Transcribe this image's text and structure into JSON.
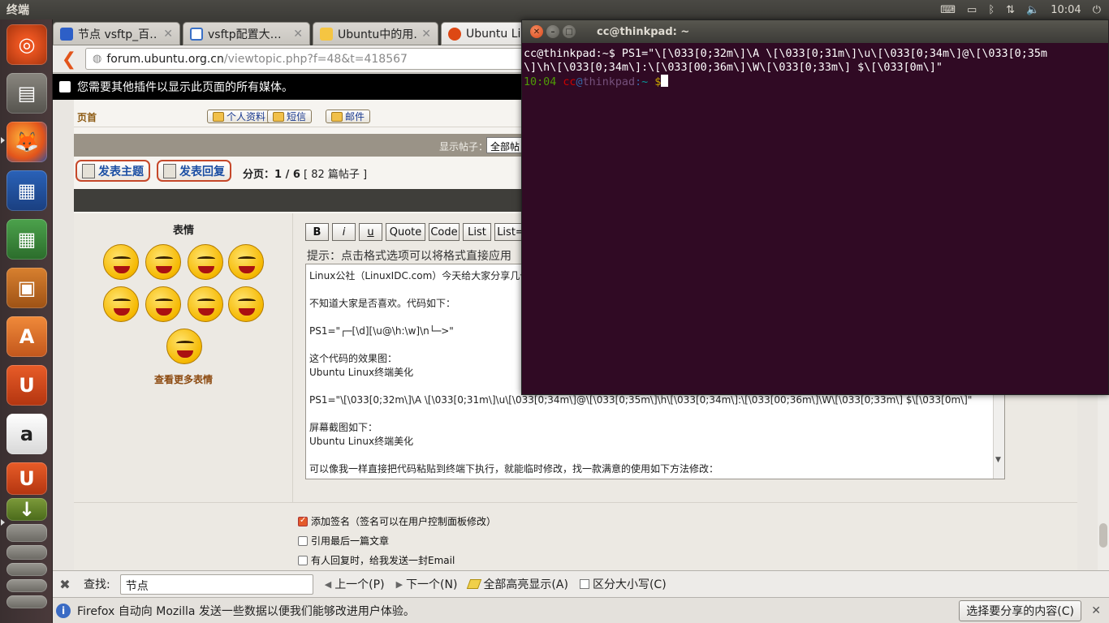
{
  "panel": {
    "app_title": "终端",
    "keyboard_icon": "keyboard-icon",
    "battery_icon": "battery-icon",
    "bluetooth_icon": "bluetooth-icon",
    "network_icon": "network-icon",
    "volume_icon": "volume-icon",
    "time": "10:04",
    "power_icon": "power-icon"
  },
  "launcher": {
    "items": [
      "dash-home",
      "files",
      "firefox",
      "libreoffice-writer",
      "libreoffice-calc",
      "libreoffice-impress",
      "ubuntu-software-center",
      "ubuntu-one",
      "amazon"
    ]
  },
  "browser": {
    "tabs": [
      {
        "title": "节点 vsftp_百…",
        "icon_color": "#2d5fc7"
      },
      {
        "title": "vsftp配置大…",
        "icon_color": "#ffffff"
      },
      {
        "title": "Ubuntu中的用…",
        "icon_color": "#f5c542"
      },
      {
        "title": "Ubuntu Linu",
        "icon_color": "#dd4814"
      }
    ],
    "url_host": "forum.ubuntu.org.cn",
    "url_path": "/viewtopic.php?f=48&t=418567",
    "plugin_message": "您需要其他插件以显示此页面的所有媒体。"
  },
  "forum": {
    "home": "页首",
    "profile_btn": "个人资料",
    "pm_btn": "短信",
    "email_btn": "邮件",
    "display_posts_label": "显示帖子：",
    "display_posts_value": "全部帖",
    "new_topic": "发表主题",
    "reply": "发表回复",
    "pagination_label": "分页：",
    "pagination_value": "1 / 6",
    "post_count": "[ 82 篇帖子 ]",
    "emoji_heading": "表情",
    "more_emoji": "查看更多表情",
    "bbcode": [
      "B",
      "i",
      "u",
      "Quote",
      "Code",
      "List",
      "List="
    ],
    "hint": "提示：点击格式选项可以将格式直接应用",
    "body_lines": [
      "Linux公社（LinuxIDC.com）今天给大家分享几个",
      "",
      "不知道大家是否喜欢。代码如下：",
      "",
      "PS1=\"┌─[\\d][\\u@\\h:\\w]\\n└─>\"",
      "",
      "这个代码的效果图：",
      "Ubuntu Linux终端美化",
      "",
      "PS1=\"\\[\\033[0;32m\\]\\A \\[\\033[0;31m\\]\\u\\[\\033[0;34m\\]@\\[\\033[0;35m\\]\\h\\[\\033[0;34m\\]:\\[\\033[00;36m\\]\\W\\[\\033[0;33m\\] $\\[\\033[0m\\]\"",
      "",
      "屏幕截图如下：",
      "Ubuntu Linux终端美化",
      "",
      "可以像我一样直接把代码粘贴到终端下执行，就能临时修改，找一款满意的使用如下方法修改："
    ],
    "attach_sig": "添加签名（签名可以在用户控制面板修改）",
    "quote_last": "引用最后一篇文章",
    "notify_reply": "有人回复时，给我发送一封Email"
  },
  "findbar": {
    "label": "查找:",
    "value": "节点",
    "prev": "上一个(P)",
    "next": "下一个(N)",
    "highlight": "全部高亮显示(A)",
    "match_case": "区分大小写(C)"
  },
  "notification": {
    "message": "Firefox 自动向 Mozilla 发送一些数据以便我们能够改进用户体验。",
    "share_btn": "选择要分享的内容(C)"
  },
  "terminal": {
    "title": "cc@thinkpad: ~",
    "line1": "cc@thinkpad:~$ PS1=\"\\[\\033[0;32m\\]\\A \\[\\033[0;31m\\]\\u\\[\\033[0;34m\\]@\\[\\033[0;35m",
    "line2": "\\]\\h\\[\\033[0;34m\\]:\\[\\033[00;36m\\]\\W\\[\\033[0;33m\\] $\\[\\033[0m\\]\"",
    "prompt_time": "10:04",
    "prompt_user": "cc",
    "prompt_at": "@",
    "prompt_host": "thinkpad",
    "prompt_colon": ":",
    "prompt_dir": "~",
    "prompt_dollar": "$"
  }
}
